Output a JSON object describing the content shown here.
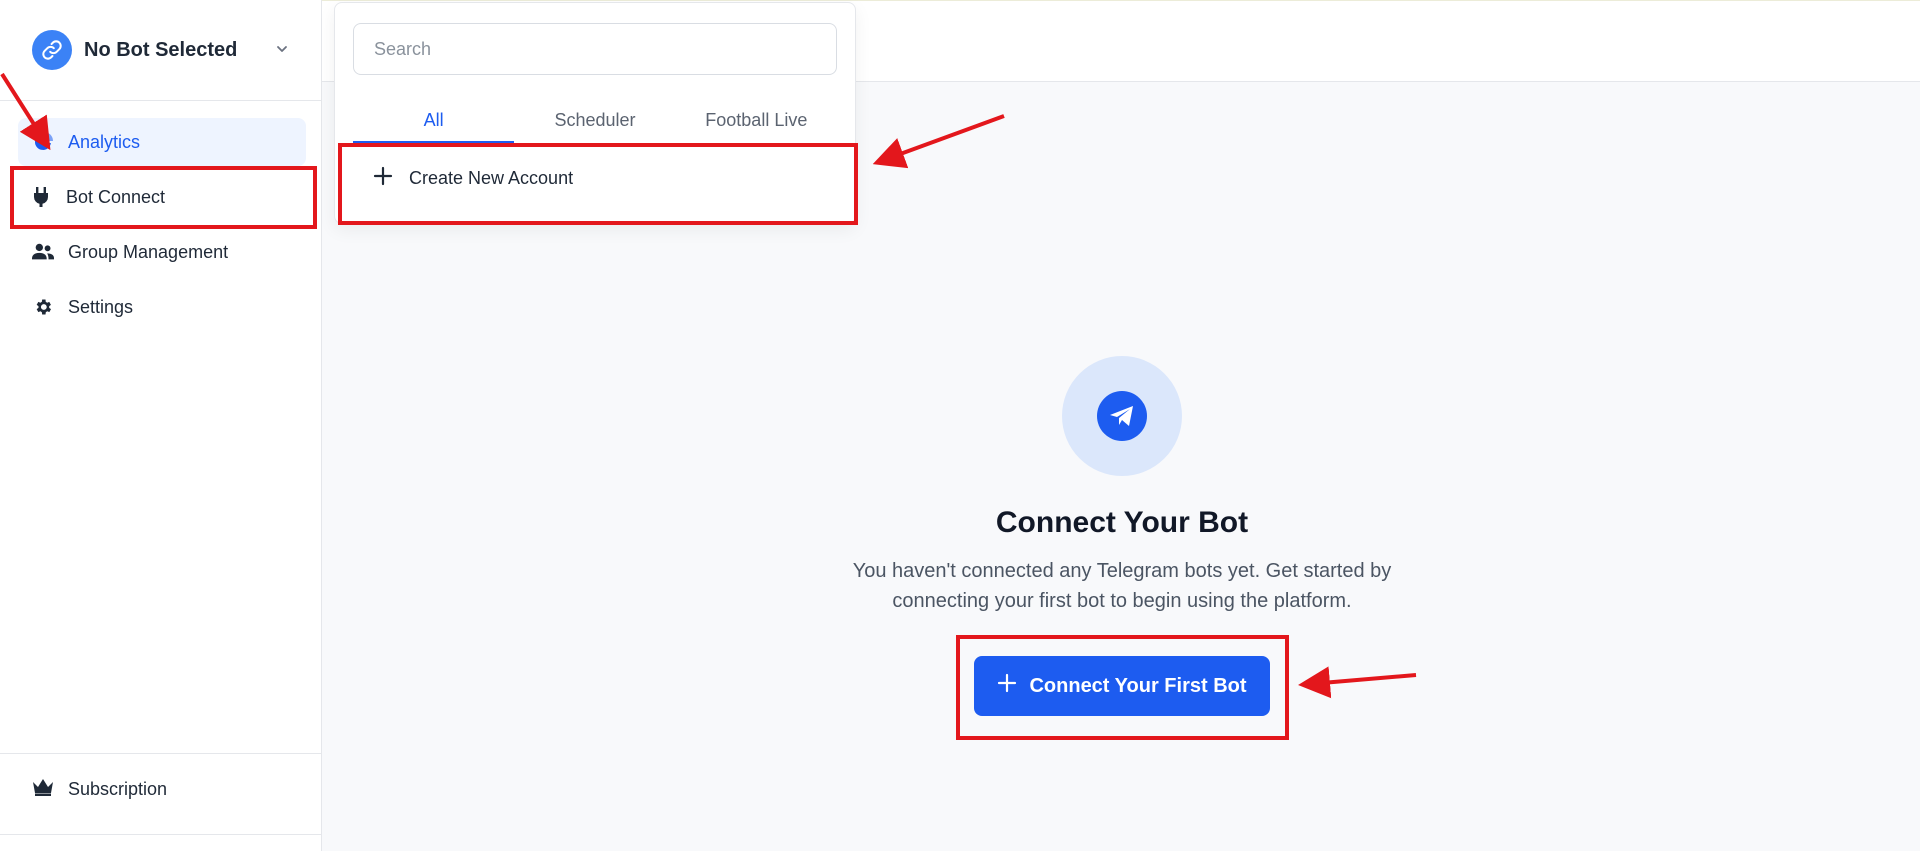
{
  "sidebar": {
    "bot_selector": {
      "label": "No Bot Selected"
    },
    "items": [
      {
        "label": "Analytics",
        "icon": "pie-chart-icon",
        "active": true
      },
      {
        "label": "Bot Connect",
        "icon": "plug-icon"
      },
      {
        "label": "Group Management",
        "icon": "users-icon"
      },
      {
        "label": "Settings",
        "icon": "gear-icon"
      }
    ],
    "footer": {
      "label": "Subscription",
      "icon": "crown-icon"
    }
  },
  "dropdown": {
    "search_placeholder": "Search",
    "tabs": [
      {
        "label": "All",
        "active": true
      },
      {
        "label": "Scheduler"
      },
      {
        "label": "Football Live"
      }
    ],
    "create_label": "Create New Account"
  },
  "empty_state": {
    "title": "Connect Your Bot",
    "description": "You haven't connected any Telegram bots yet. Get started by connecting your first bot to begin using the platform.",
    "button_label": "Connect Your First Bot",
    "icon": "telegram-icon"
  },
  "colors": {
    "accent": "#1d5cf0",
    "annotation": "#e3171c"
  }
}
